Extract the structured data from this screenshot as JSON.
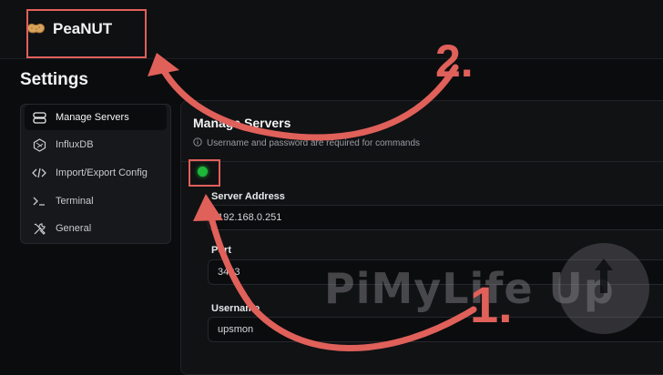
{
  "app": {
    "name": "PeaNUT"
  },
  "page": {
    "title": "Settings"
  },
  "sidebar": {
    "items": [
      {
        "label": "Manage Servers",
        "icon": "server-icon",
        "active": true
      },
      {
        "label": "InfluxDB",
        "icon": "influxdb-icon",
        "active": false
      },
      {
        "label": "Import/Export Config",
        "icon": "code-icon",
        "active": false
      },
      {
        "label": "Terminal",
        "icon": "terminal-icon",
        "active": false
      },
      {
        "label": "General",
        "icon": "tools-icon",
        "active": false
      }
    ]
  },
  "main": {
    "title": "Manage Servers",
    "note": "Username and password are required for commands",
    "server": {
      "status": "connected",
      "status_color": "#1db83a",
      "address_label": "Server Address",
      "address_value": "192.168.0.251",
      "port_label": "Port",
      "port_value": "3493",
      "username_label": "Username",
      "username_value": "upsmon"
    }
  },
  "annotations": {
    "step1": "1.",
    "step2": "2.",
    "color": "#e0605a"
  },
  "watermark": {
    "text": "PiMyLife Up"
  }
}
